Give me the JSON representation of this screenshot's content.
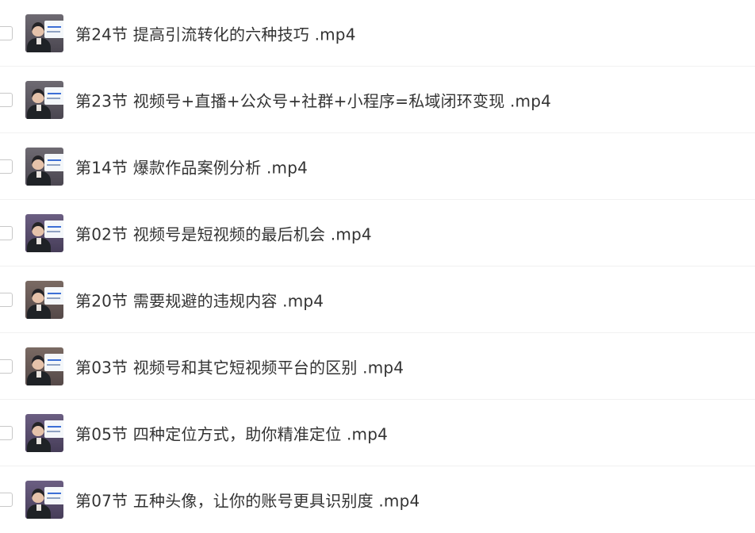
{
  "files": [
    {
      "name": "第24节 提高引流转化的六种技巧 .mp4",
      "thumbnail_icon": "video-thumbnail-icon"
    },
    {
      "name": "第23节 视频号+直播+公众号+社群+小程序=私域闭环变现 .mp4",
      "thumbnail_icon": "video-thumbnail-icon"
    },
    {
      "name": "第14节 爆款作品案例分析 .mp4",
      "thumbnail_icon": "video-thumbnail-icon"
    },
    {
      "name": "第02节 视频号是短视频的最后机会 .mp4",
      "thumbnail_icon": "video-thumbnail-icon"
    },
    {
      "name": "第20节 需要规避的违规内容 .mp4",
      "thumbnail_icon": "video-thumbnail-icon"
    },
    {
      "name": "第03节 视频号和其它短视频平台的区别 .mp4",
      "thumbnail_icon": "video-thumbnail-icon"
    },
    {
      "name": "第05节 四种定位方式，助你精准定位 .mp4",
      "thumbnail_icon": "video-thumbnail-icon"
    },
    {
      "name": "第07节 五种头像，让你的账号更具识别度 .mp4",
      "thumbnail_icon": "video-thumbnail-icon"
    }
  ],
  "colors": {
    "text": "#333333",
    "divider": "#f1f1f1",
    "checkbox_border": "#c8c8c8"
  }
}
